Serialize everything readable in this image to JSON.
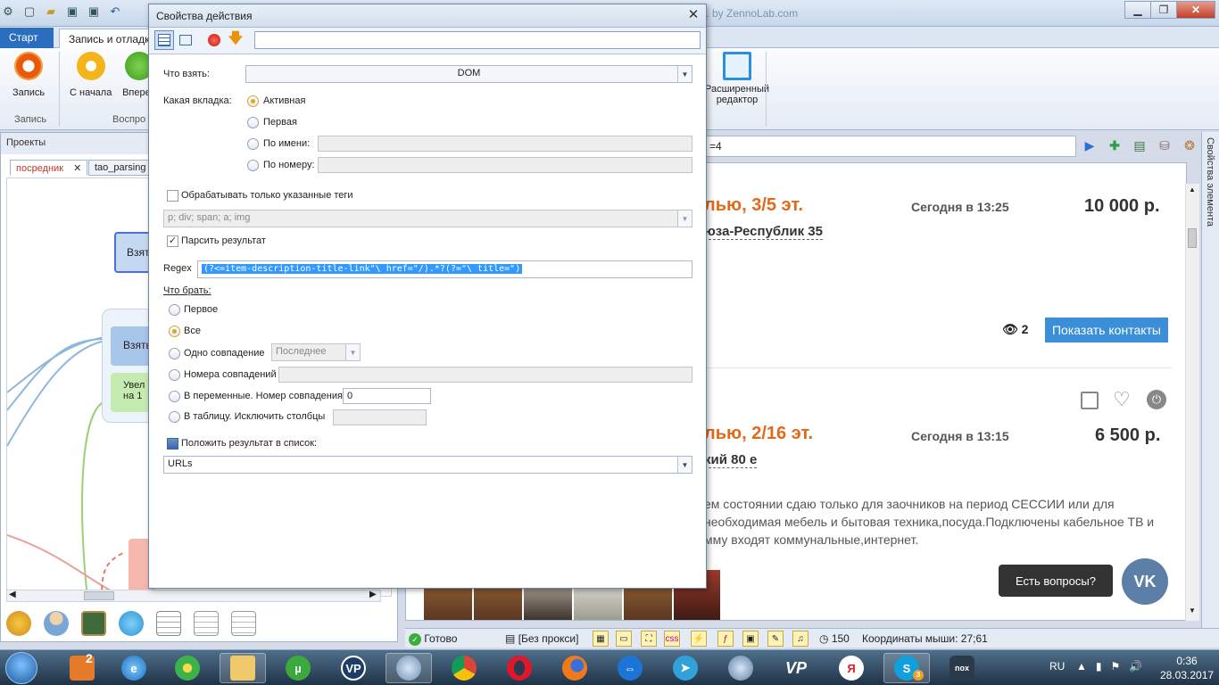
{
  "app": {
    "title_fragment": "1 by ZennoLab.com",
    "qat_icons": [
      "shield-icon",
      "new-file-icon",
      "open-folder-icon",
      "save-icon",
      "save-all-icon",
      "undo-icon"
    ]
  },
  "ribbon": {
    "tabs": {
      "start": "Старт",
      "record": "Запись и отладка"
    },
    "buttons": {
      "record": "Запись",
      "from_start": "С начала",
      "forward": "Вперед",
      "extended_editor_line1": "Расширенный",
      "extended_editor_line2": "редактор"
    },
    "groups": {
      "record": "Запись",
      "playback": "Воспро"
    }
  },
  "projects": {
    "header": "Проекты",
    "tabs": [
      "посредник",
      "tao_parsing"
    ],
    "nodes": {
      "take": "Взять",
      "take2": "Взять",
      "increase_line1": "Увел",
      "increase_line2": "на 1"
    }
  },
  "browser": {
    "address": "=4",
    "side_tab": "Свойства элемента",
    "listing1": {
      "title": "лью, 3/5 эт.",
      "date": "Сегодня в 13:25",
      "price": "10 000 р.",
      "address": "юза-Республик 35",
      "views": "2",
      "button": "Показать контакты"
    },
    "listing2": {
      "title": "лью, 2/16 эт.",
      "date": "Сегодня в 13:15",
      "price": "6 500 р.",
      "address": "кий 80 е",
      "desc_line1": "ем состоянии сдаю только для заочников на период СЕССИИ или для",
      "desc_line2": "необходимая мебель и бытовая техника,посуда.Подключены кабельное ТВ и",
      "desc_line3": "мму входят коммунальные,интернет."
    },
    "chat": "Есть вопросы?",
    "vk": "VK"
  },
  "statusbar": {
    "ready": "Готово",
    "proxy": "[Без прокси]",
    "count": "150",
    "mouse": "Координаты мыши: 27;61"
  },
  "dialog": {
    "title": "Свойства действия",
    "search_value": "",
    "what_to_take_label": "Что взять:",
    "what_to_take_value": "DOM",
    "which_tab_label": "Какая вкладка:",
    "tab_options": {
      "active": "Активная",
      "first": "Первая",
      "by_name": "По имени:",
      "by_number": "По номеру:"
    },
    "by_name_value": "",
    "by_number_value": "",
    "only_tags_label": "Обрабатывать только указанные теги",
    "tags_value": "p; div; span; a; img",
    "parse_result_label": "Парсить результат",
    "regex_label": "Regex",
    "regex_value": "(?<=item-description-title-link\"\\ href=\"/).*?(?=\"\\ title=\")",
    "take_what_label": "Что брать:",
    "take_options": {
      "first": "Первое",
      "all": "Все",
      "one_match": "Одно совпадение",
      "match_numbers": "Номера совпадений",
      "to_vars": "В переменные. Номер совпадения",
      "to_table": "В таблицу. Исключить столбцы"
    },
    "one_match_value": "Последнее",
    "match_numbers_value": "",
    "to_vars_value": "0",
    "to_table_value": "",
    "put_result_label": "Положить результат в список:",
    "list_value": "URLs"
  },
  "taskbar": {
    "apps": [
      "folder-icon",
      "utorrent-icon",
      "vpn-icon",
      "zennoposter-icon",
      "chrome-icon",
      "opera-icon",
      "firefox-icon",
      "teamviewer-icon",
      "telegram-icon",
      "zennodroid-icon",
      "vp-icon",
      "yandex-icon",
      "skype-icon",
      "nox-icon"
    ],
    "lang": "RU",
    "time": "0:36",
    "date": "28.03.2017",
    "skype_badge": "3",
    "badge_2": "2"
  },
  "colors": {
    "accent": "#2a6fbf",
    "orange_title": "#e06a1a",
    "contacts_btn": "#3a8fd8",
    "selection": "#3399ff"
  }
}
